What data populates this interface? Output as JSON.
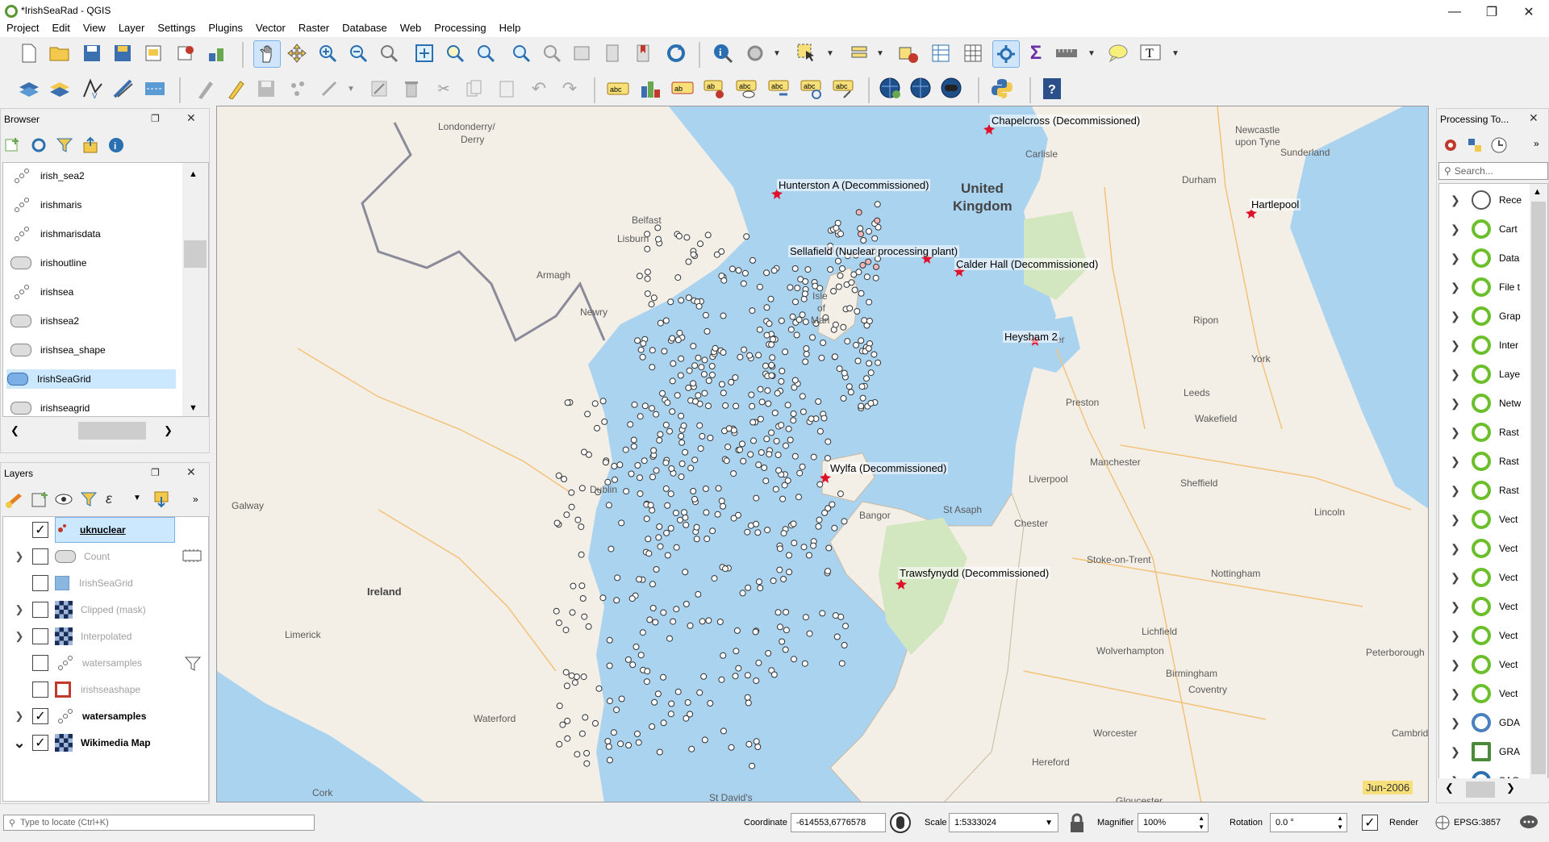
{
  "window": {
    "title": "*IrishSeaRad - QGIS"
  },
  "menu": [
    "Project",
    "Edit",
    "View",
    "Layer",
    "Settings",
    "Plugins",
    "Vector",
    "Raster",
    "Database",
    "Web",
    "Processing",
    "Help"
  ],
  "toolbar_icons": {
    "row1": [
      "new-project-icon",
      "open-project-icon",
      "save-project-icon",
      "save-as-icon",
      "print-layout-icon",
      "style-manager-icon",
      "pan-icon",
      "pan-to-selection-icon",
      "zoom-in-icon",
      "zoom-out-icon",
      "zoom-native-icon",
      "zoom-full-icon",
      "zoom-selection-icon",
      "zoom-layer-icon",
      "zoom-last-icon",
      "zoom-next-icon",
      "new-map-view-icon",
      "new-bookmark-icon",
      "show-bookmarks-icon",
      "refresh-icon",
      "identify-icon",
      "action-icon",
      "select-features-icon",
      "select-value-icon",
      "deselect-icon",
      "attribute-table-icon",
      "field-calculator-icon",
      "statistics-icon",
      "sum-icon",
      "measure-icon",
      "map-tips-icon",
      "text-annotation-icon"
    ],
    "row2": [
      "add-vector-icon",
      "add-spatialite-icon",
      "add-wms-icon",
      "add-virtual-icon",
      "add-delimited-icon",
      "digitize-icon",
      "edit-pencil-icon",
      "save-edits-icon",
      "add-feature-icon",
      "vertex-tool-icon",
      "modify-attributes-icon",
      "delete-icon",
      "cut-icon",
      "copy-icon",
      "paste-icon",
      "undo-icon",
      "redo-icon",
      "label-abc-icon",
      "diagram-icon",
      "label-highlight-icon",
      "pin-label-icon",
      "show-label-icon",
      "move-label-icon",
      "rotate-label-icon",
      "change-label-icon",
      "globe-icon",
      "globe-zoom-icon",
      "globe-settings-icon",
      "python-icon",
      "help-icon"
    ]
  },
  "browser": {
    "title": "Browser",
    "items": [
      {
        "name": "irish_sea2",
        "type": "point"
      },
      {
        "name": "irishmaris",
        "type": "point"
      },
      {
        "name": "irishmarisdata",
        "type": "point"
      },
      {
        "name": "irishoutline",
        "type": "polygon"
      },
      {
        "name": "irishsea",
        "type": "point"
      },
      {
        "name": "irishsea2",
        "type": "polygon"
      },
      {
        "name": "irishsea_shape",
        "type": "polygon"
      },
      {
        "name": "IrishSeaGrid",
        "type": "polygon",
        "selected": true
      },
      {
        "name": "irishseagrid",
        "type": "polygon"
      }
    ]
  },
  "layers": {
    "title": "Layers",
    "items": [
      {
        "name": "uknuclear",
        "checked": true,
        "bold": true,
        "underline": true,
        "highlight": true,
        "icon": "point-red-icon"
      },
      {
        "name": "Count",
        "checked": false,
        "expand": true,
        "icon": "polygon-icon",
        "grey": true
      },
      {
        "name": "IrishSeaGrid",
        "checked": false,
        "icon": "square-blue-icon",
        "grey": true
      },
      {
        "name": "Clipped (mask)",
        "checked": false,
        "expand": true,
        "icon": "raster-icon",
        "grey": true
      },
      {
        "name": "Interpolated",
        "checked": false,
        "expand": true,
        "icon": "raster-icon",
        "grey": true
      },
      {
        "name": "watersamples",
        "checked": false,
        "icon": "point-icon",
        "grey": true
      },
      {
        "name": "irishseashape",
        "checked": false,
        "icon": "square-red-icon",
        "grey": true
      },
      {
        "name": "watersamples",
        "checked": true,
        "expand": true,
        "bold": true,
        "icon": "point-icon"
      },
      {
        "name": "Wikimedia Map",
        "checked": true,
        "expanded": true,
        "bold": true,
        "icon": "raster-icon"
      }
    ]
  },
  "map": {
    "nuclear_sites": [
      {
        "label": "Chapelcross (Decommissioned)"
      },
      {
        "label": "Hunterston A (Decommissioned)"
      },
      {
        "label": "Hartlepool"
      },
      {
        "label": "Sellafield (Nuclear processing plant)"
      },
      {
        "label": "Calder Hall (Decommissioned)"
      },
      {
        "label": "Heysham 2"
      },
      {
        "label": "Wylfa (Decommissioned)"
      },
      {
        "label": "Trawsfynydd (Decommissioned)"
      }
    ],
    "places": [
      "Londonderry/",
      "Derry",
      "Carlisle",
      "Newcastle",
      "upon Tyne",
      "Sunderland",
      "Durham",
      "United",
      "Kingdom",
      "Belfast",
      "Lisburn",
      "Armagh",
      "Newry",
      "Isle",
      "of",
      "Man",
      "Ripon",
      "York",
      "Leeds",
      "Preston",
      "Wakefield",
      "Manchester",
      "Sheffield",
      "Liverpool",
      "Dublin",
      "Galway",
      "Bangor",
      "St Asaph",
      "Chester",
      "Lincoln",
      "Stoke-on-Trent",
      "Nottingham",
      "Ireland",
      "Limerick",
      "Lichfield",
      "Wolverhampton",
      "Peterborough",
      "Birmingham",
      "Coventry",
      "Waterford",
      "Worcester",
      "Cambrid",
      "Hereford",
      "Cork",
      "St David's",
      "Gloucester",
      "er"
    ],
    "date_stamp": "Jun-2006"
  },
  "processing": {
    "title": "Processing To...",
    "search_placeholder": "Search...",
    "items": [
      "Rece",
      "Cart",
      "Data",
      "File t",
      "Grap",
      "Inter",
      "Laye",
      "Netw",
      "Rast",
      "Rast",
      "Rast",
      "Vect",
      "Vect",
      "Vect",
      "Vect",
      "Vect",
      "Vect",
      "Vect",
      "GDA",
      "GRA",
      "SAG"
    ]
  },
  "status": {
    "locate_placeholder": "Type to locate (Ctrl+K)",
    "coordinate_label": "Coordinate",
    "coordinate": "-614553,6776578",
    "scale_label": "Scale",
    "scale": "1:5333024",
    "magnifier_label": "Magnifier",
    "magnifier": "100%",
    "rotation_label": "Rotation",
    "rotation": "0.0 °",
    "render_label": "Render",
    "crs": "EPSG:3857"
  },
  "colors": {
    "sea": "#aad3f0",
    "land": "#f4efe6",
    "park": "#d2e6c0",
    "selection": "#cce8ff",
    "qgis_green": "#589632"
  }
}
